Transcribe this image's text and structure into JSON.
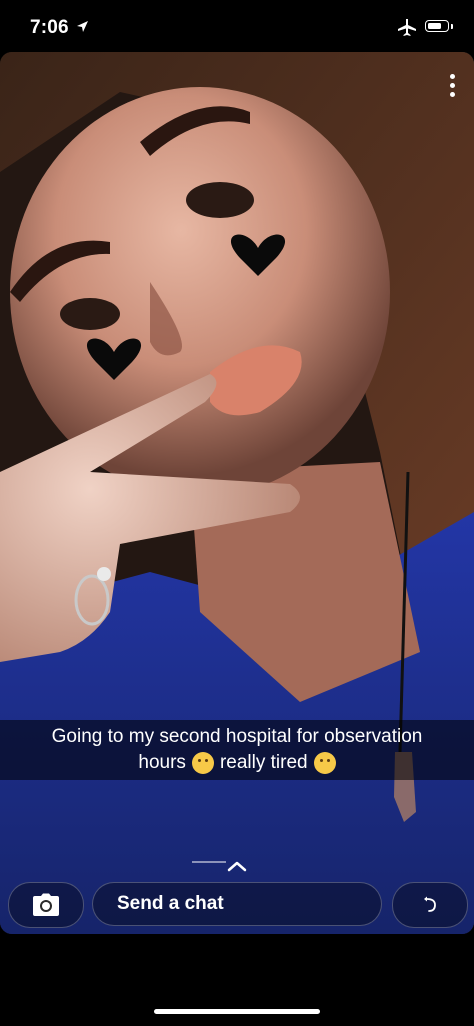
{
  "status_bar": {
    "time": "7:06",
    "icons": [
      "location-arrow-icon",
      "airplane-icon",
      "battery-icon"
    ],
    "battery_level": 0.75
  },
  "snap": {
    "menu_icon": "more-vertical-icon",
    "caption_line1": "Going to my second hospital for observation",
    "caption_line2_a": "hours",
    "caption_line2_b": "really tired",
    "caption_emojis": [
      "partying-face-emoji",
      "yawning-face-emoji"
    ],
    "sticker_icons": [
      "black-heart-icon",
      "black-heart-icon"
    ],
    "swipe_icon": "chevron-up-icon"
  },
  "bottom_bar": {
    "camera_icon": "camera-icon",
    "chat_placeholder": "Send a chat",
    "reply_icon": "reply-arrow-icon"
  },
  "colors": {
    "shirt": "#1d2f85",
    "caption_bg": "rgba(0,0,0,0.55)",
    "text": "#ffffff"
  }
}
